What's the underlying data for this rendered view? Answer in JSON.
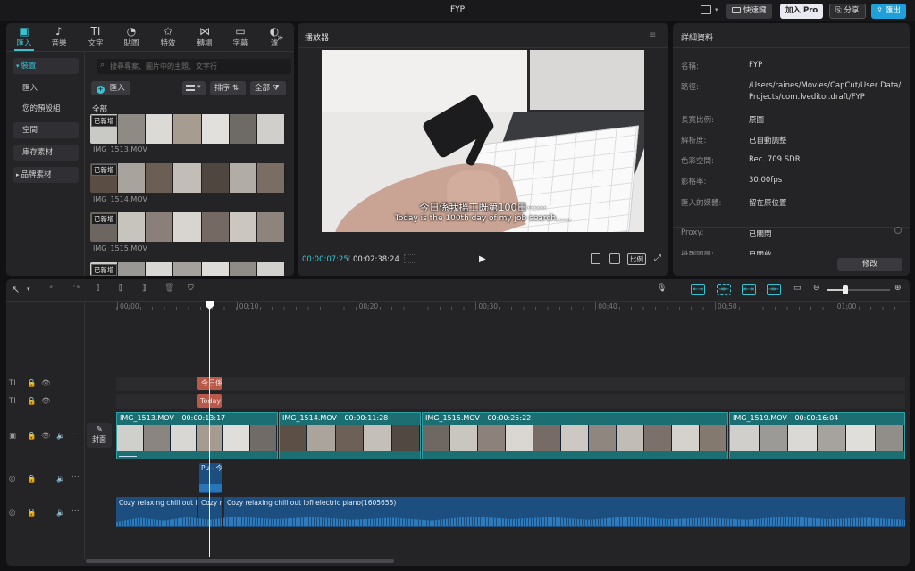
{
  "app": {
    "title": "FYP",
    "top_right": {
      "shortcut_label": "快速鍵",
      "pro_label": "加入 Pro",
      "share_label": "分享",
      "export_label": "匯出"
    }
  },
  "media_panel": {
    "tabs": [
      {
        "label": "匯入",
        "icon": "import-icon",
        "glyph": "▣",
        "active": true
      },
      {
        "label": "音樂",
        "icon": "music-icon",
        "glyph": "♪",
        "active": false
      },
      {
        "label": "文字",
        "icon": "text-icon",
        "glyph": "TI",
        "active": false
      },
      {
        "label": "貼圖",
        "icon": "sticker-icon",
        "glyph": "◔",
        "active": false
      },
      {
        "label": "特效",
        "icon": "effects-icon",
        "glyph": "✩",
        "active": false
      },
      {
        "label": "轉場",
        "icon": "transition-icon",
        "glyph": "⋈",
        "active": false
      },
      {
        "label": "字幕",
        "icon": "subtitle-icon",
        "glyph": "▭",
        "active": false
      },
      {
        "label": "濾",
        "icon": "filter-icon",
        "glyph": "◐",
        "active": false
      }
    ],
    "sidebar": [
      {
        "label": "裝置",
        "arrow": "▾",
        "selected": true,
        "boxed": true
      },
      {
        "label": "匯入",
        "arrow": "",
        "selected": false,
        "boxed": false
      },
      {
        "label": "您的預設組",
        "arrow": "",
        "selected": false,
        "boxed": false
      },
      {
        "label": "空間",
        "arrow": "",
        "selected": false,
        "boxed": true
      },
      {
        "label": "庫存素材",
        "arrow": "",
        "selected": false,
        "boxed": true
      },
      {
        "label": "品牌素材",
        "arrow": "▸",
        "selected": false,
        "boxed": true
      }
    ],
    "search_placeholder": "搜尋專案、圖片中的主題、文字行",
    "import_button": "匯入",
    "sort_label": "排序",
    "filter_label": "全部",
    "section_label": "全部",
    "new_badge": "已新增",
    "items": [
      {
        "name": "IMG_1513.MOV"
      },
      {
        "name": "IMG_1514.MOV"
      },
      {
        "name": "IMG_1515.MOV"
      },
      {
        "name": ""
      }
    ]
  },
  "player": {
    "title": "播放器",
    "subtitle_cn": "今日係我搵工既第100日⋯⋯",
    "subtitle_en": "Today is the 100th day of my job search......",
    "current_time": "00:00:07:25",
    "total_time": "00:02:38:24",
    "ratio_label": "比例"
  },
  "details": {
    "title": "詳細資料",
    "rows": [
      {
        "key": "名稱:",
        "value": "FYP"
      },
      {
        "key": "路徑:",
        "value": "/Users/raines/Movies/CapCut/User Data/",
        "value2": "Projects/com.lveditor.draft/FYP"
      },
      {
        "key": "長寬比例:",
        "value": "原圖"
      },
      {
        "key": "解析度:",
        "value": "已自動調整"
      },
      {
        "key": "色彩空間:",
        "value": "Rec. 709 SDR"
      },
      {
        "key": "影格率:",
        "value": "30.00fps"
      },
      {
        "key": "匯入的媒體:",
        "value": "留在原位置"
      },
      {
        "key": "Proxy:",
        "value": "已關閉"
      },
      {
        "key": "排列圖層:",
        "value": "已開啟"
      }
    ],
    "edit_button": "修改"
  },
  "timeline": {
    "ruler": [
      "00:00",
      "00:10",
      "00:20",
      "00:30",
      "00:40",
      "00:50",
      "01:00"
    ],
    "text_clip_1": "今日係",
    "text_clip_2": "Today",
    "cover_label": "封面",
    "video_clips": [
      {
        "name": "IMG_1513.MOV",
        "duration": "00:00:13:17"
      },
      {
        "name": "IMG_1514.MOV",
        "duration": "00:00:11:28"
      },
      {
        "name": "IMG_1515.MOV",
        "duration": "00:00:25:22"
      },
      {
        "name": "IMG_1519.MOV",
        "duration": "00:00:16:04"
      }
    ],
    "audio_small_clip": "Pu - 今",
    "audio_clips": [
      "Cozy relaxing chill out lo",
      "Cozy n",
      "Cozy relaxing chill out lofi electric piano(1605655)"
    ]
  },
  "colors": {
    "accent": "#35c4d6",
    "video_clip": "#1b6f73",
    "text_clip": "#b8594a",
    "audio_clip": "#1c4f7f"
  }
}
